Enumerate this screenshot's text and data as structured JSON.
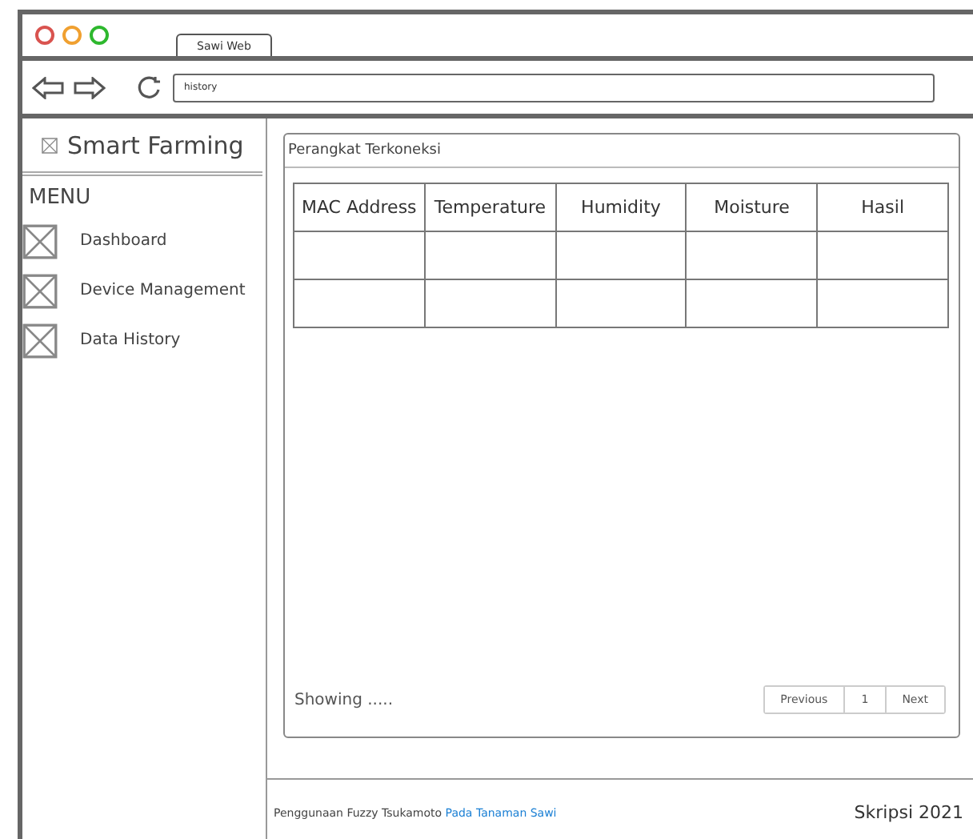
{
  "window": {
    "tab": "Sawi Web",
    "address": "history"
  },
  "sidebar": {
    "title": "Smart Farming",
    "menu_label": "MENU",
    "items": [
      {
        "label": "Dashboard"
      },
      {
        "label": "Device Management"
      },
      {
        "label": "Data History"
      }
    ]
  },
  "panel": {
    "title": "Perangkat Terkoneksi",
    "table": {
      "columns": [
        "MAC Address",
        "Temperature",
        "Humidity",
        "Moisture",
        "Hasil"
      ],
      "rows": [
        [
          "",
          "",
          "",
          "",
          ""
        ],
        [
          "",
          "",
          "",
          "",
          ""
        ]
      ]
    },
    "showing": "Showing .....",
    "pagination": [
      {
        "label": "Previous"
      },
      {
        "label": "1"
      },
      {
        "label": "Next"
      }
    ]
  },
  "footer": {
    "text": "Penggunaan Fuzzy Tsukamoto **Pada Tanaman Sawi**",
    "right": "Skripsi 2021"
  }
}
